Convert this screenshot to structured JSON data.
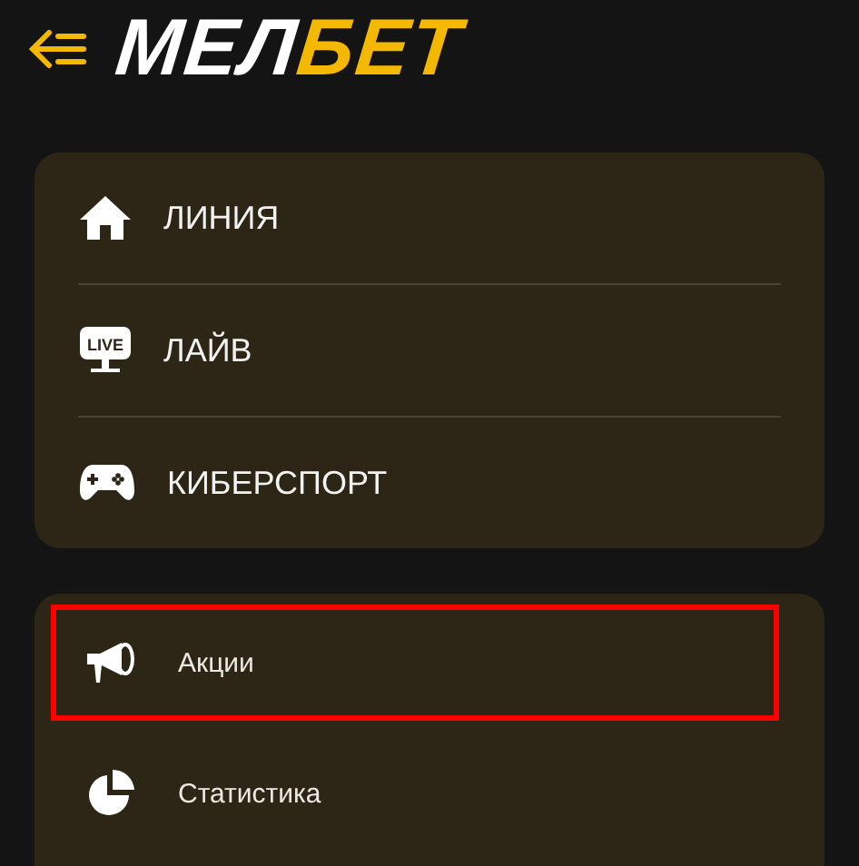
{
  "header": {
    "logo": {
      "part_1": "МЕЛ",
      "part_2": "БЕТ"
    }
  },
  "main_menu": [
    {
      "label": "ЛИНИЯ"
    },
    {
      "icon_text": "LIVE",
      "label": "ЛАЙВ"
    },
    {
      "label": "КИБЕРСПОРТ"
    }
  ],
  "secondary_menu": [
    {
      "label": "Акции",
      "highlighted": true
    },
    {
      "label": "Статистика",
      "highlighted": false
    }
  ]
}
